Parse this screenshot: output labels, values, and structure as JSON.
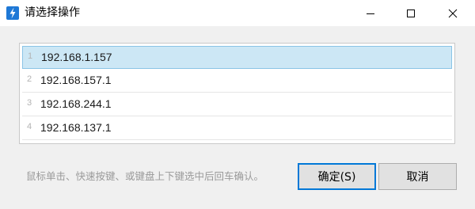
{
  "window": {
    "title": "请选择操作",
    "icon": "lightning-icon",
    "accent_color": "#1e78d6"
  },
  "list": {
    "items": [
      {
        "index": "1",
        "ip": "192.168.1.157",
        "selected": true
      },
      {
        "index": "2",
        "ip": "192.168.157.1",
        "selected": false
      },
      {
        "index": "3",
        "ip": "192.168.244.1",
        "selected": false
      },
      {
        "index": "4",
        "ip": "192.168.137.1",
        "selected": false
      }
    ]
  },
  "hint": "鼠标单击、快速按键、或键盘上下键选中后回车确认。",
  "buttons": {
    "ok_label": "确定(S)",
    "cancel_label": "取消"
  }
}
